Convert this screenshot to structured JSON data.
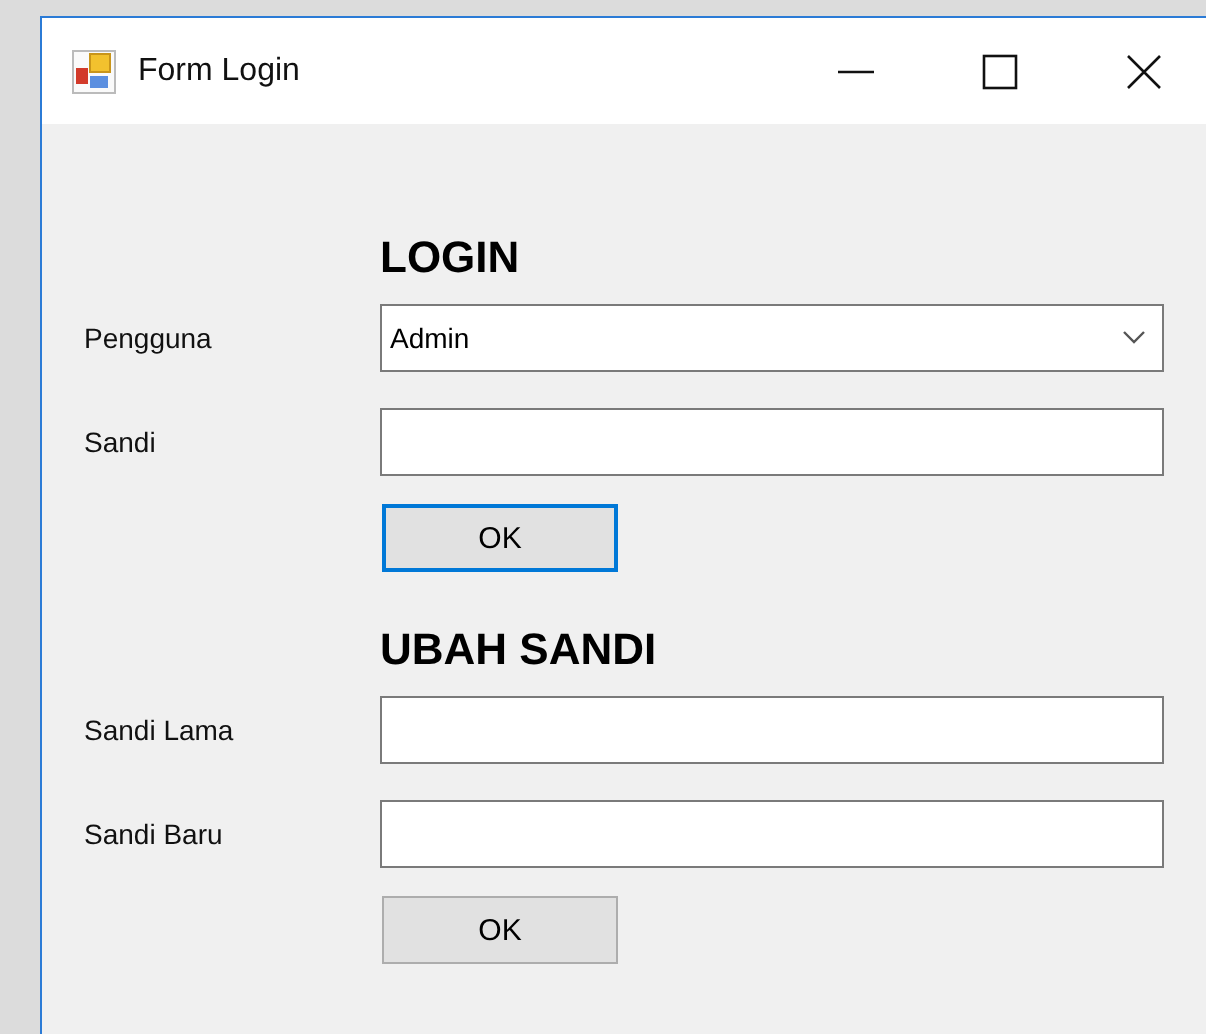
{
  "window": {
    "title": "Form Login"
  },
  "sections": [
    {
      "heading": "LOGIN",
      "fields": [
        {
          "label": "Pengguna",
          "kind": "combo",
          "value": "Admin"
        },
        {
          "label": "Sandi",
          "kind": "text"
        }
      ],
      "button": {
        "label": "OK",
        "focused": true
      }
    },
    {
      "heading": "UBAH SANDI",
      "fields": [
        {
          "label": "Sandi Lama",
          "kind": "text"
        },
        {
          "label": "Sandi Baru",
          "kind": "text"
        }
      ],
      "button": {
        "label": "OK",
        "focused": false
      }
    }
  ]
}
